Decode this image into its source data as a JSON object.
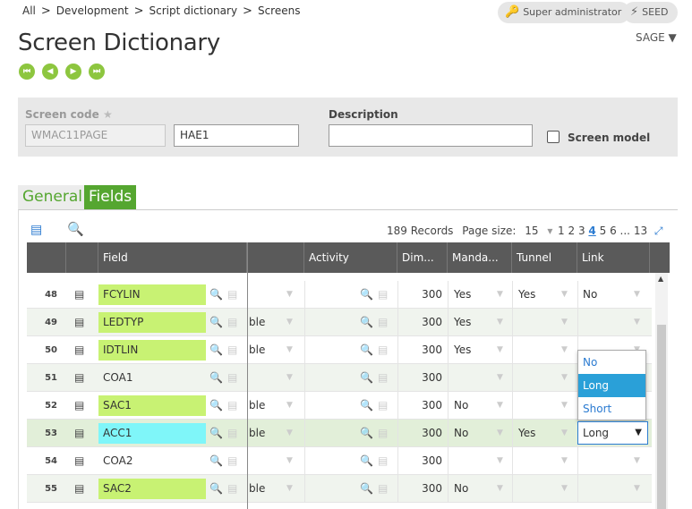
{
  "breadcrumb": [
    "All",
    "Development",
    "Script dictionary",
    "Screens"
  ],
  "breadcrumb_sep": ">",
  "header": {
    "user_role": "Super administrator",
    "folder": "SEED",
    "title": "Screen Dictionary",
    "company": "SAGE"
  },
  "form": {
    "screen_code_label": "Screen code",
    "screen_code_value": "WMAC11PAGE",
    "screen_code_2": "HAE1",
    "description_label": "Description",
    "description_value": "",
    "screen_model_label": "Screen model"
  },
  "tabs": [
    {
      "label": "General",
      "active": false
    },
    {
      "label": "Fields",
      "active": true
    }
  ],
  "grid": {
    "records": "189 Records",
    "page_size_label": "Page size:",
    "page_size": "15",
    "pages": [
      "1",
      "2",
      "3",
      "4",
      "5",
      "6",
      "...",
      "13"
    ],
    "current_page": "4",
    "columns": [
      "Field",
      "",
      "Activity",
      "Dim...",
      "Manda...",
      "Tunnel",
      "Link"
    ],
    "rows": [
      {
        "num": "48",
        "field": "FCYLIN",
        "color": "green",
        "col2": "",
        "dim": "300",
        "mand": "Yes",
        "tunnel": "Yes",
        "link": "No"
      },
      {
        "num": "49",
        "field": "LEDTYP",
        "color": "green",
        "col2": "ble",
        "dim": "300",
        "mand": "Yes",
        "tunnel": "",
        "link": ""
      },
      {
        "num": "50",
        "field": "IDTLIN",
        "color": "green",
        "col2": "ble",
        "dim": "300",
        "mand": "Yes",
        "tunnel": "",
        "link": ""
      },
      {
        "num": "51",
        "field": "COA1",
        "color": "none",
        "col2": "",
        "dim": "300",
        "mand": "",
        "tunnel": "",
        "link": ""
      },
      {
        "num": "52",
        "field": "SAC1",
        "color": "green",
        "col2": "ble",
        "dim": "300",
        "mand": "No",
        "tunnel": "",
        "link": ""
      },
      {
        "num": "53",
        "field": "ACC1",
        "color": "cyan",
        "col2": "ble",
        "dim": "300",
        "mand": "No",
        "tunnel": "Yes",
        "link": "Long"
      },
      {
        "num": "54",
        "field": "COA2",
        "color": "none",
        "col2": "",
        "dim": "300",
        "mand": "",
        "tunnel": "",
        "link": ""
      },
      {
        "num": "55",
        "field": "SAC2",
        "color": "green",
        "col2": "ble",
        "dim": "300",
        "mand": "No",
        "tunnel": "",
        "link": ""
      }
    ]
  },
  "link_dropdown": {
    "options": [
      "No",
      "Long",
      "Short"
    ],
    "selected": "Long"
  }
}
